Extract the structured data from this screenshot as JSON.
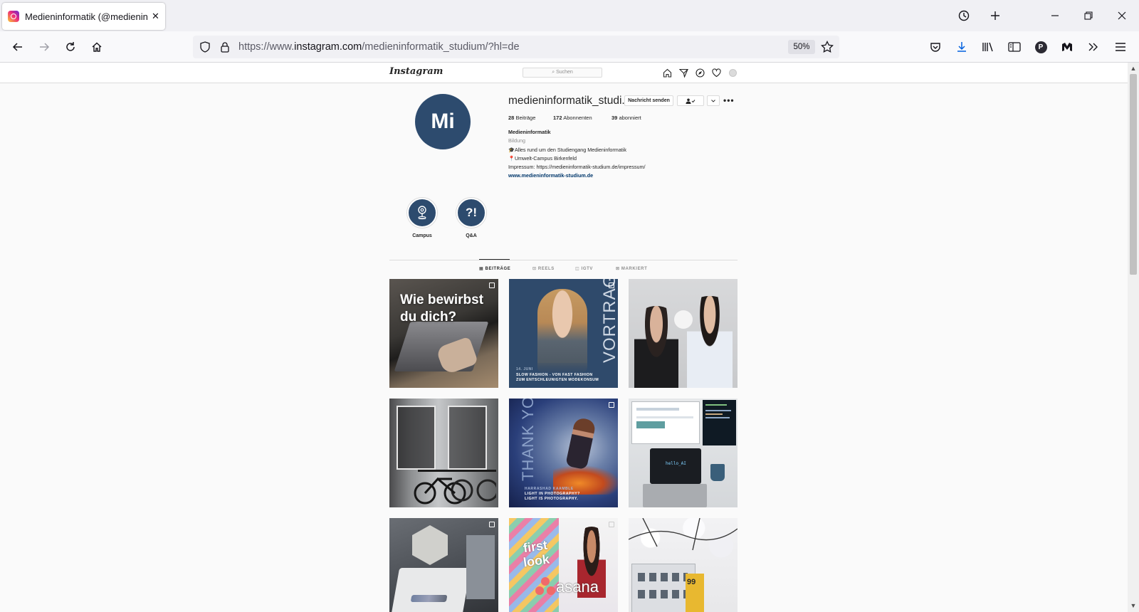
{
  "browser": {
    "tab_title": "Medieninformatik (@medieninformatik_studium)",
    "url_prefix": "https://www.",
    "url_domain": "instagram.com",
    "url_path": "/medieninformatik_studium/?hl=de",
    "zoom": "50%"
  },
  "instagram": {
    "logo": "Instagram",
    "search_placeholder": "Suchen"
  },
  "profile": {
    "avatar_text": "Mi",
    "username": "medieninformatik_studi...",
    "message_button": "Nachricht senden",
    "posts_count": "28",
    "posts_label": "Beiträge",
    "followers_count": "172",
    "followers_label": "Abonnenten",
    "following_count": "39",
    "following_label": "abonniert",
    "bio_name": "Medieninformatik",
    "bio_category": "Bildung",
    "bio_line1": "🎓Alles rund um den Studiengang Medieninformatik",
    "bio_line2": "📍Umwelt-Campus Birkenfeld",
    "bio_line3": "Impressum: https://medieninformatik-studium.de/impressum/",
    "website": "www.medieninformatik-studium.de"
  },
  "highlights": [
    {
      "label": "Campus",
      "icon_text": ""
    },
    {
      "label": "Q&A",
      "icon_text": "?!"
    }
  ],
  "tabs": [
    "BEITRÄGE",
    "REELS",
    "IGTV",
    "MARKIERT"
  ],
  "posts": {
    "p1_text": "Wie bewirbst du dich?",
    "p2_side": "VORTRAG",
    "p2_date": "14. JUNI",
    "p2_caption1": "SLOW FASHION - VON FAST FASHION",
    "p2_caption2": "ZUM ENTSCHLEUNIGTEN MODEKONSUM",
    "p5_side": "THANK YOU",
    "p5_name": "HARRASHAD KAAMBLE",
    "p5_caption1": "LIGHT IN PHOTOGRAPHY?",
    "p5_caption2": "LIGHT IS PHOTOGRAPHY.",
    "p8_text1": "first",
    "p8_text2": "look",
    "p8_brand": "asana",
    "p9_number": "99"
  }
}
